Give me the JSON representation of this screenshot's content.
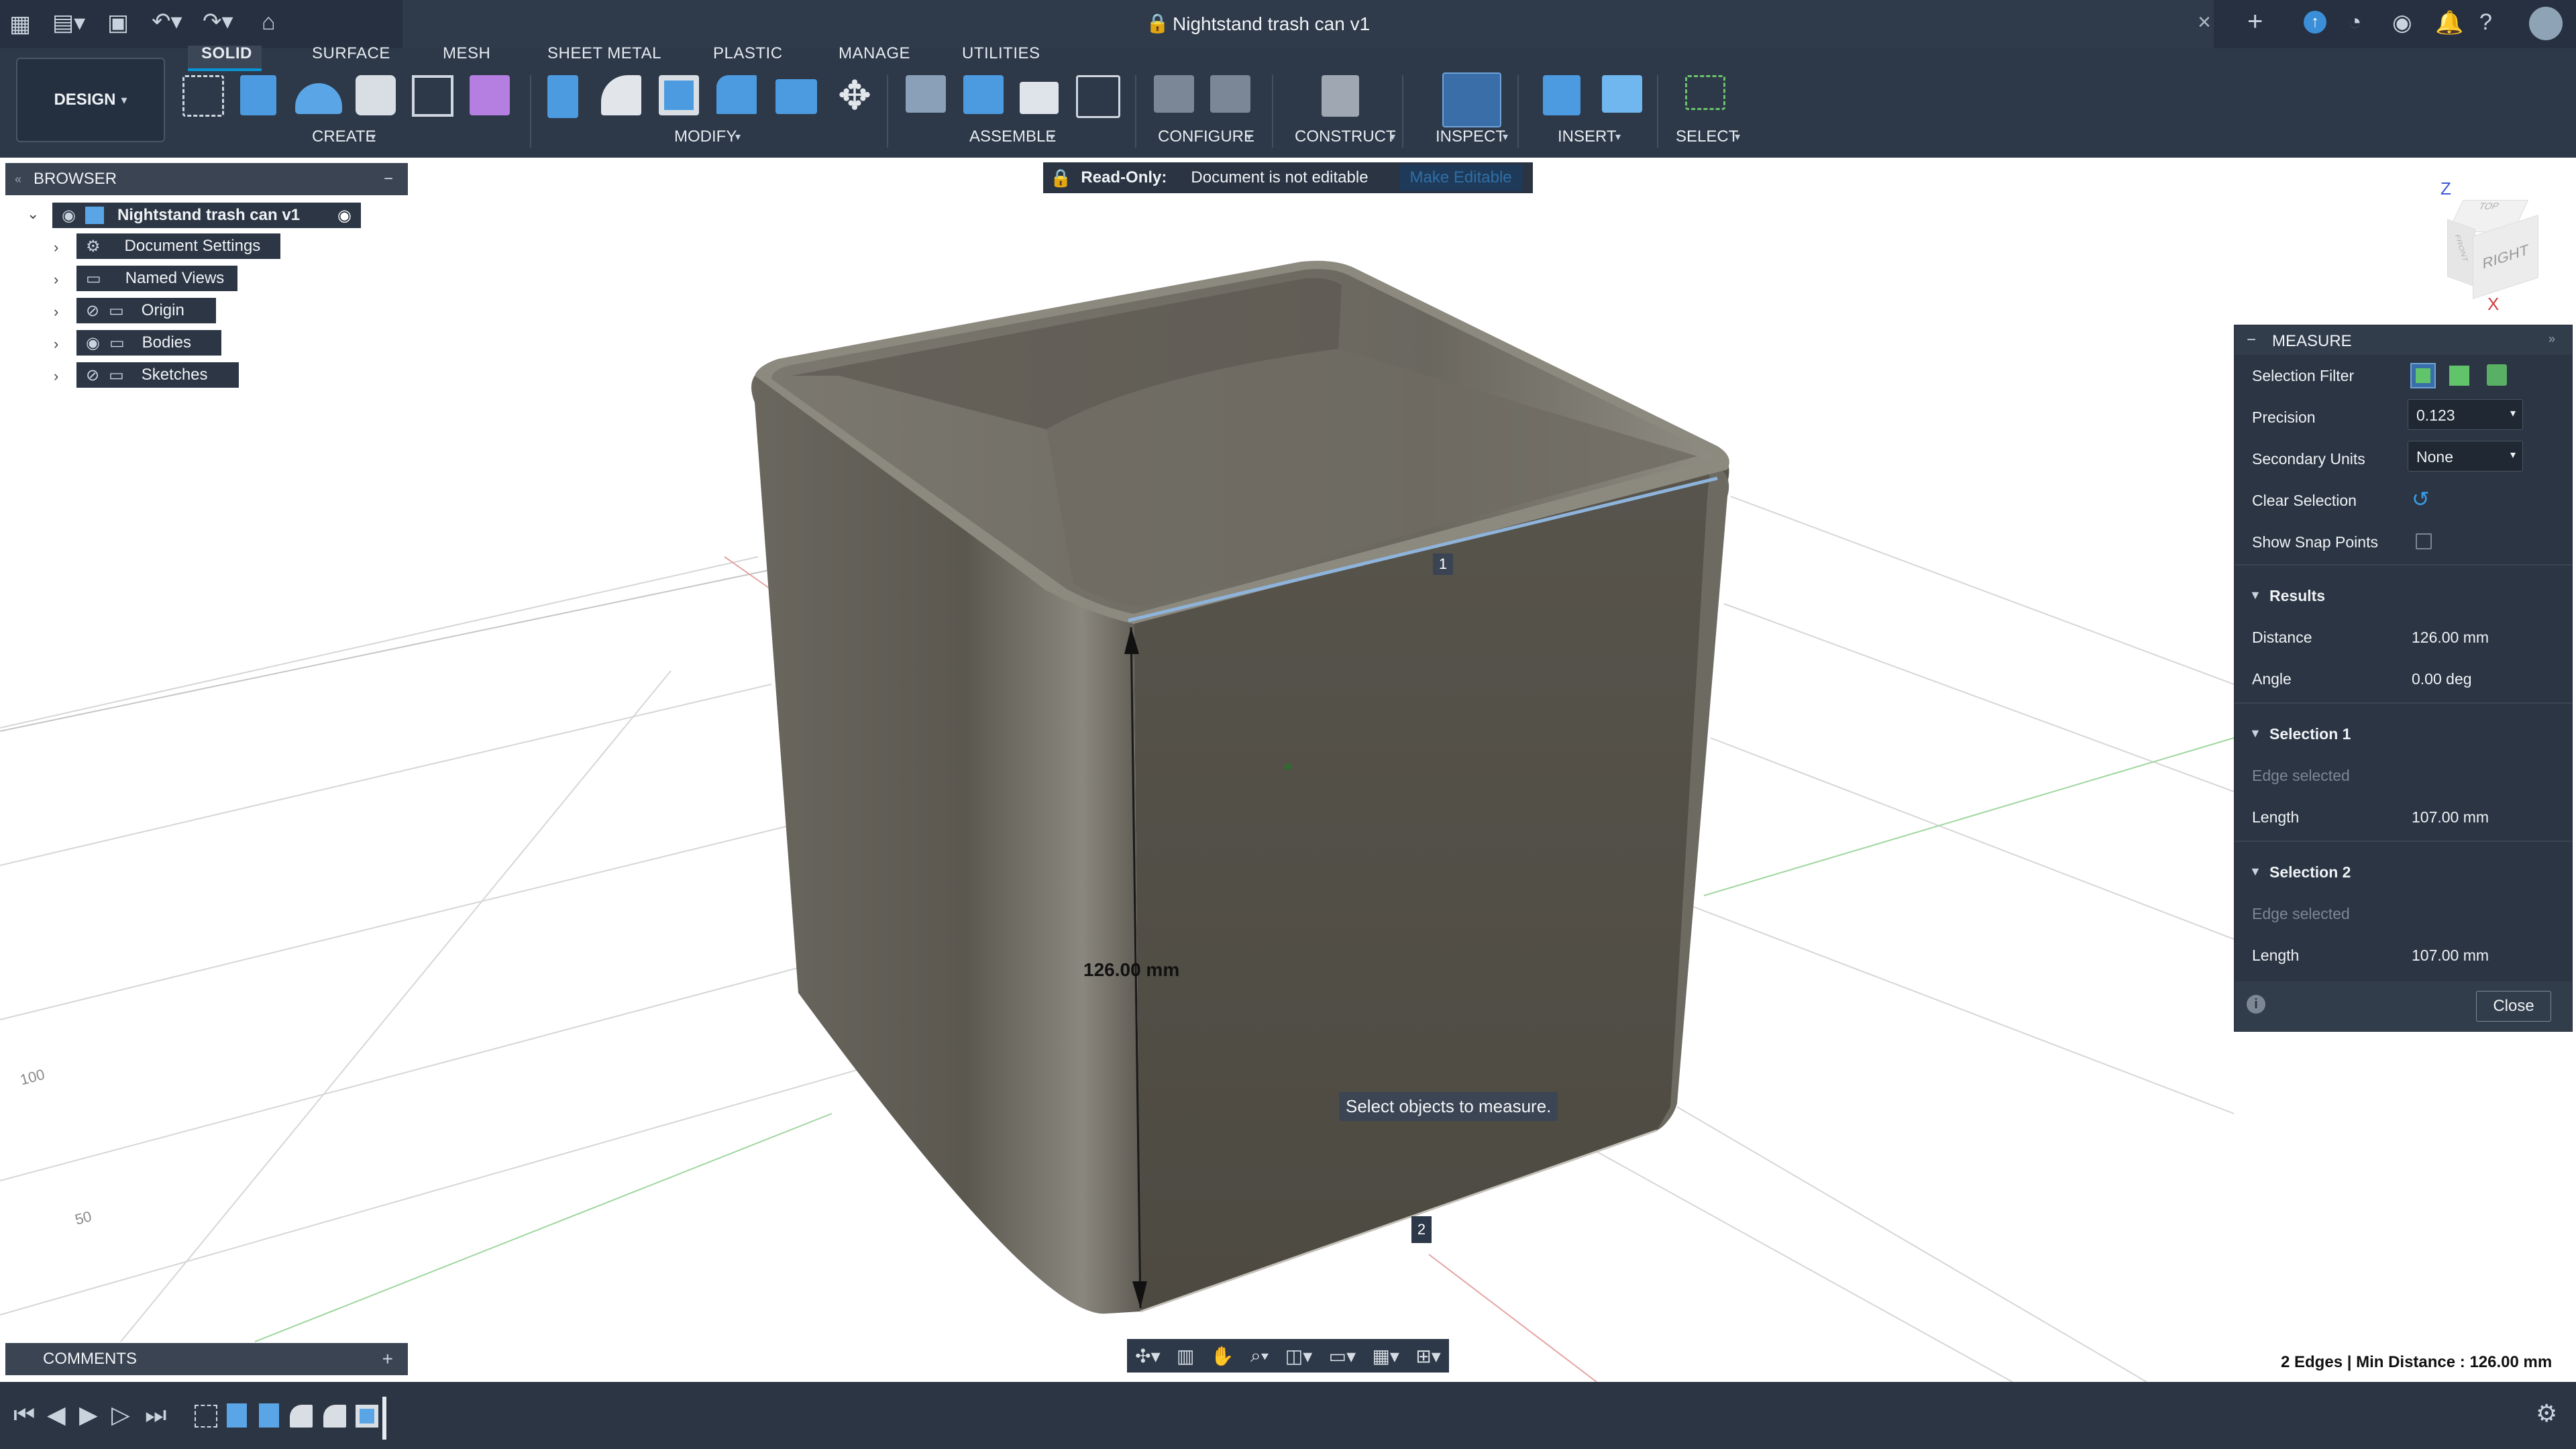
{
  "app": {
    "title": "Nightstand trash can v1"
  },
  "toolbar": {
    "design_label": "DESIGN",
    "tabs": [
      "SOLID",
      "SURFACE",
      "MESH",
      "SHEET METAL",
      "PLASTIC",
      "MANAGE",
      "UTILITIES"
    ],
    "active_tab": "SOLID",
    "groups": [
      "CREATE",
      "MODIFY",
      "ASSEMBLE",
      "CONFIGURE",
      "CONSTRUCT",
      "INSPECT",
      "INSERT",
      "SELECT"
    ]
  },
  "banner": {
    "label": "Read-Only:",
    "message": "Document is not editable",
    "action": "Make Editable"
  },
  "browser": {
    "title": "BROWSER",
    "root": "Nightstand trash can v1",
    "items": [
      "Document Settings",
      "Named Views",
      "Origin",
      "Bodies",
      "Sketches"
    ]
  },
  "comments": {
    "title": "COMMENTS"
  },
  "viewcube": {
    "face": "RIGHT",
    "top": "TOP",
    "front": "FRONT",
    "axis_z": "Z",
    "axis_x": "X"
  },
  "measure": {
    "title": "MEASURE",
    "selection_filter_label": "Selection Filter",
    "precision_label": "Precision",
    "precision_value": "0.123",
    "secondary_units_label": "Secondary Units",
    "secondary_units_value": "None",
    "clear_selection_label": "Clear Selection",
    "snap_points_label": "Show Snap Points",
    "results_title": "Results",
    "distance_label": "Distance",
    "distance_value": "126.00 mm",
    "angle_label": "Angle",
    "angle_value": "0.00 deg",
    "sel1_title": "Selection 1",
    "sel1_type": "Edge selected",
    "sel1_length_label": "Length",
    "sel1_length_value": "107.00 mm",
    "sel2_title": "Selection 2",
    "sel2_type": "Edge selected",
    "sel2_length_label": "Length",
    "sel2_length_value": "107.00 mm",
    "close_label": "Close"
  },
  "viewport": {
    "dimension_label": "126.00 mm",
    "marker1": "1",
    "marker2": "2",
    "tooltip": "Select objects to measure.",
    "grid_label_100": "100",
    "grid_label_50": "50"
  },
  "status": {
    "text": "2 Edges | Min Distance : 126.00 mm"
  },
  "colors": {
    "accent": "#0696d7",
    "panel": "#2b3543",
    "header": "#263040",
    "body": "#545149"
  }
}
